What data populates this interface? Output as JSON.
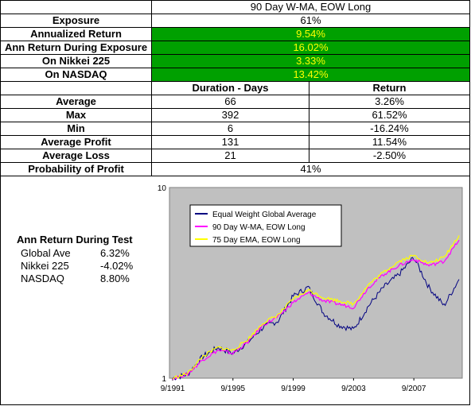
{
  "strategy_title": "90 Day W-MA, EOW Long",
  "summary": [
    {
      "label": "Exposure",
      "value": "61%",
      "highlight": false
    },
    {
      "label": "Annualized Return",
      "value": "9.54%",
      "highlight": true
    },
    {
      "label": "Ann Return During Exposure",
      "value": "16.02%",
      "highlight": true
    },
    {
      "label": "On Nikkei 225",
      "value": "3.33%",
      "highlight": true
    },
    {
      "label": "On NASDAQ",
      "value": "13.42%",
      "highlight": true
    }
  ],
  "stats_headers": {
    "duration": "Duration - Days",
    "return": "Return"
  },
  "stats": [
    {
      "label": "Average",
      "duration": "66",
      "return": "3.26%"
    },
    {
      "label": "Max",
      "duration": "392",
      "return": "61.52%"
    },
    {
      "label": "Min",
      "duration": "6",
      "return": "-16.24%"
    },
    {
      "label": "Average Profit",
      "duration": "131",
      "return": "11.54%"
    },
    {
      "label": "Average Loss",
      "duration": "21",
      "return": "-2.50%"
    }
  ],
  "probability": {
    "label": "Probability of Profit",
    "value": "41%"
  },
  "test_returns": {
    "title": "Ann Return During Test",
    "rows": [
      {
        "name": "Global Ave",
        "value": "6.32%"
      },
      {
        "name": "Nikkei 225",
        "value": "-4.02%"
      },
      {
        "name": "NASDAQ",
        "value": "8.80%"
      }
    ]
  },
  "chart_data": {
    "type": "line",
    "y_scale": "log",
    "ylim": [
      1,
      10
    ],
    "y_ticks": [
      "1",
      "10"
    ],
    "x_ticks": [
      "9/1991",
      "9/1995",
      "9/1999",
      "9/2003",
      "9/2007"
    ],
    "legend_position": "top-left",
    "grid": false,
    "plot_bg": "#c0c0c0",
    "x": [
      "9/1991",
      "1992",
      "1993",
      "1994",
      "1995",
      "1996",
      "1997",
      "1998",
      "1999",
      "2000",
      "2001",
      "2002",
      "2003",
      "2004",
      "2005",
      "2006",
      "2007",
      "2008",
      "2009",
      "2010"
    ],
    "series": [
      {
        "name": "Equal Weight Global Average",
        "color": "#000080",
        "values": [
          1.0,
          1.05,
          1.3,
          1.45,
          1.35,
          1.55,
          1.85,
          2.0,
          2.7,
          3.0,
          2.2,
          1.9,
          1.8,
          2.4,
          3.0,
          3.5,
          4.3,
          3.0,
          2.4,
          3.3
        ]
      },
      {
        "name": "90 Day W-MA, EOW Long",
        "color": "#ff00ff",
        "values": [
          1.0,
          1.05,
          1.25,
          1.4,
          1.35,
          1.55,
          1.9,
          2.1,
          2.5,
          2.8,
          2.55,
          2.45,
          2.35,
          3.0,
          3.5,
          3.9,
          4.2,
          3.9,
          4.1,
          5.3
        ]
      },
      {
        "name": "75 Day EMA, EOW Long",
        "color": "#ffff00",
        "values": [
          1.0,
          1.06,
          1.3,
          1.45,
          1.4,
          1.6,
          1.95,
          2.15,
          2.6,
          2.9,
          2.65,
          2.55,
          2.45,
          3.1,
          3.6,
          4.1,
          4.4,
          4.0,
          4.3,
          5.6
        ]
      }
    ]
  }
}
